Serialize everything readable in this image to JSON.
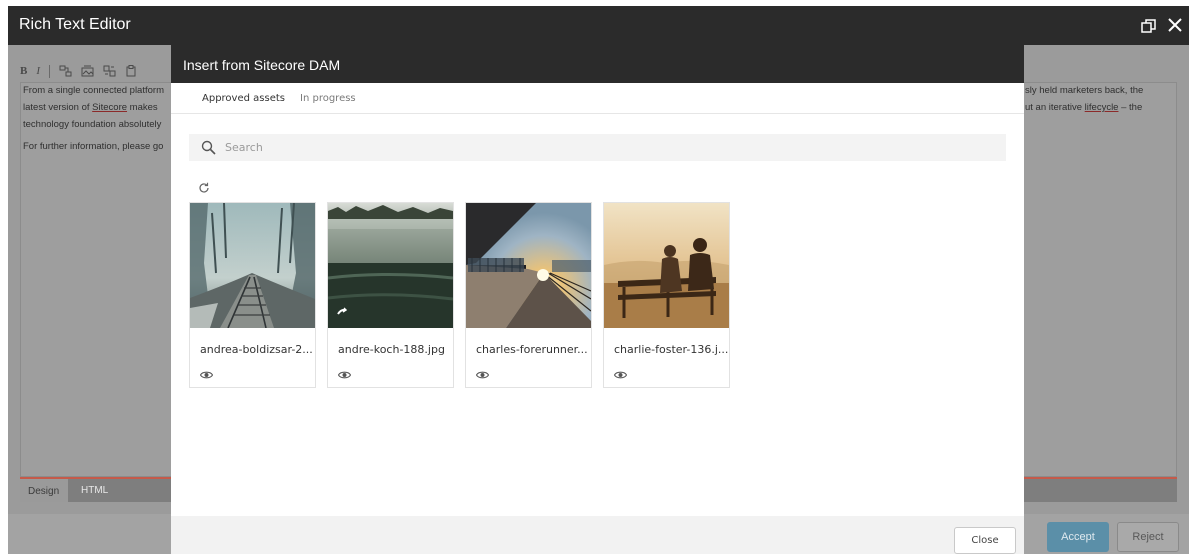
{
  "window": {
    "title": "Rich Text Editor",
    "toolbar": {
      "bold_label": "B",
      "italic_label": "I"
    },
    "content_lines_left": [
      "From a single connected platform",
      "latest version of ",
      "technology foundation absolutely",
      "For further information, please go"
    ],
    "sitecore_link": "Sitecore",
    "latest_after_link": " makes",
    "content_lines_right": [
      "sly held marketers back, the",
      "ut an iterative ",
      " – the"
    ],
    "lifecycle_link": "lifecycle",
    "mode_tabs": {
      "design": "Design",
      "html": "HTML"
    },
    "accept_label": "Accept",
    "reject_label": "Reject"
  },
  "dialog": {
    "title": "Insert from Sitecore DAM",
    "tabs": {
      "approved": "Approved assets",
      "in_progress": "In progress"
    },
    "search_placeholder": "Search",
    "assets": [
      {
        "name": "andrea-boldizsar-2..."
      },
      {
        "name": "andre-koch-188.jpg"
      },
      {
        "name": "charles-forerunner..."
      },
      {
        "name": "charlie-foster-136.j..."
      }
    ],
    "close_label": "Close"
  }
}
